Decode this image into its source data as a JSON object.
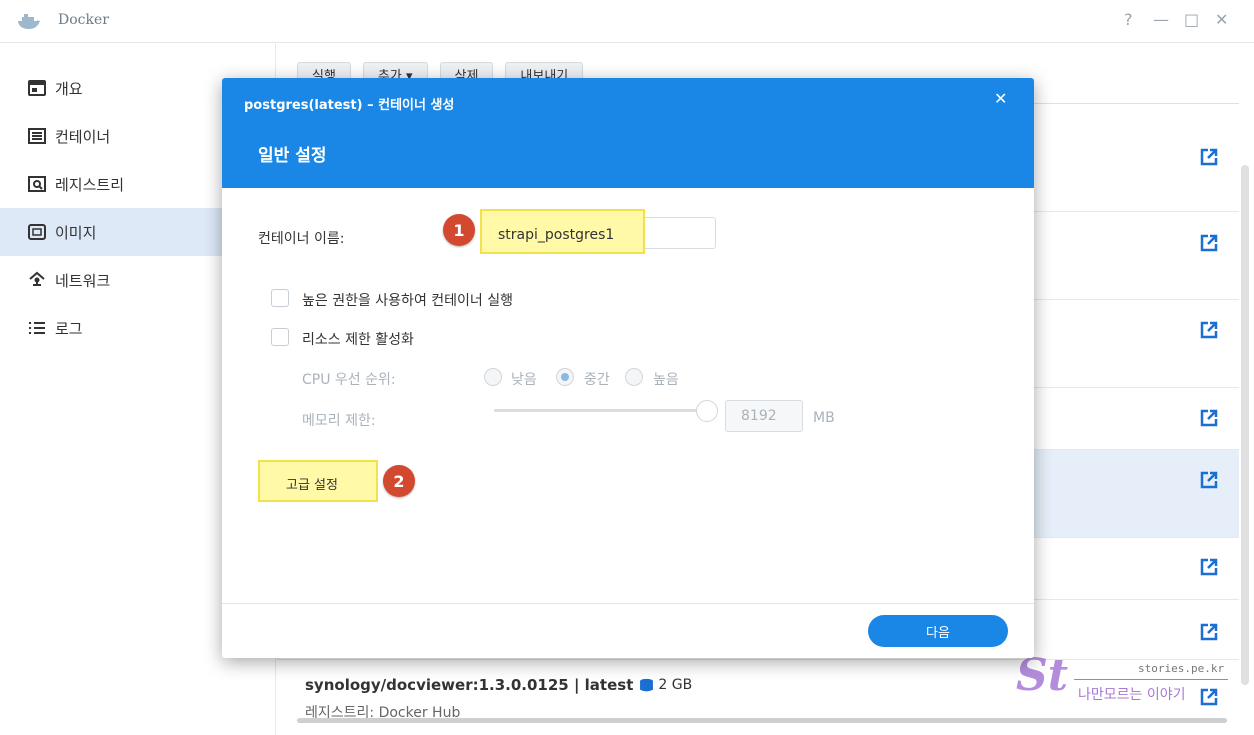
{
  "window": {
    "title": "Docker",
    "controls": [
      "?",
      "—",
      "□",
      "✕"
    ]
  },
  "sidebar": {
    "items": [
      {
        "label": "개요",
        "icon": "overview-icon"
      },
      {
        "label": "컨테이너",
        "icon": "container-icon"
      },
      {
        "label": "레지스트리",
        "icon": "registry-icon"
      },
      {
        "label": "이미지",
        "icon": "image-icon",
        "active": true
      },
      {
        "label": "네트워크",
        "icon": "network-icon"
      },
      {
        "label": "로그",
        "icon": "log-icon"
      }
    ]
  },
  "toolbar": {
    "buttons": [
      "실행",
      "추가 ▾",
      "삭제",
      "내보내기"
    ]
  },
  "background_list": {
    "bottom_item": {
      "name": "synology/docviewer:1.3.0.0125 | latest",
      "size": "2 GB",
      "registry": "레지스트리: Docker Hub"
    }
  },
  "modal": {
    "title": "postgres(latest) – 컨테이너 생성",
    "subtitle": "일반 설정",
    "close": "✕",
    "container_name_label": "컨테이너 이름:",
    "container_name_value": "strapi_postgres1",
    "privileged_label": "높은 권한을 사용하여 컨테이너 실행",
    "resource_limit_label": "리소스 제한 활성화",
    "cpu_priority_label": "CPU 우선 순위:",
    "cpu_options": [
      "낮음",
      "중간",
      "높음"
    ],
    "cpu_selected": "중간",
    "memory_label": "메모리 제한:",
    "memory_value": "8192",
    "memory_unit": "MB",
    "advanced_button": "고급 설정",
    "next_button": "다음"
  },
  "annotations": {
    "badge_1": "1",
    "badge_2": "2"
  },
  "watermark": {
    "logo": "St",
    "url": "stories.pe.kr",
    "text": "나만모르는 이야기"
  },
  "colors": {
    "accent": "#1a87e6",
    "highlight": "#fff9a8",
    "badge": "#d2492f",
    "sidebar_active": "#dde9f7"
  }
}
